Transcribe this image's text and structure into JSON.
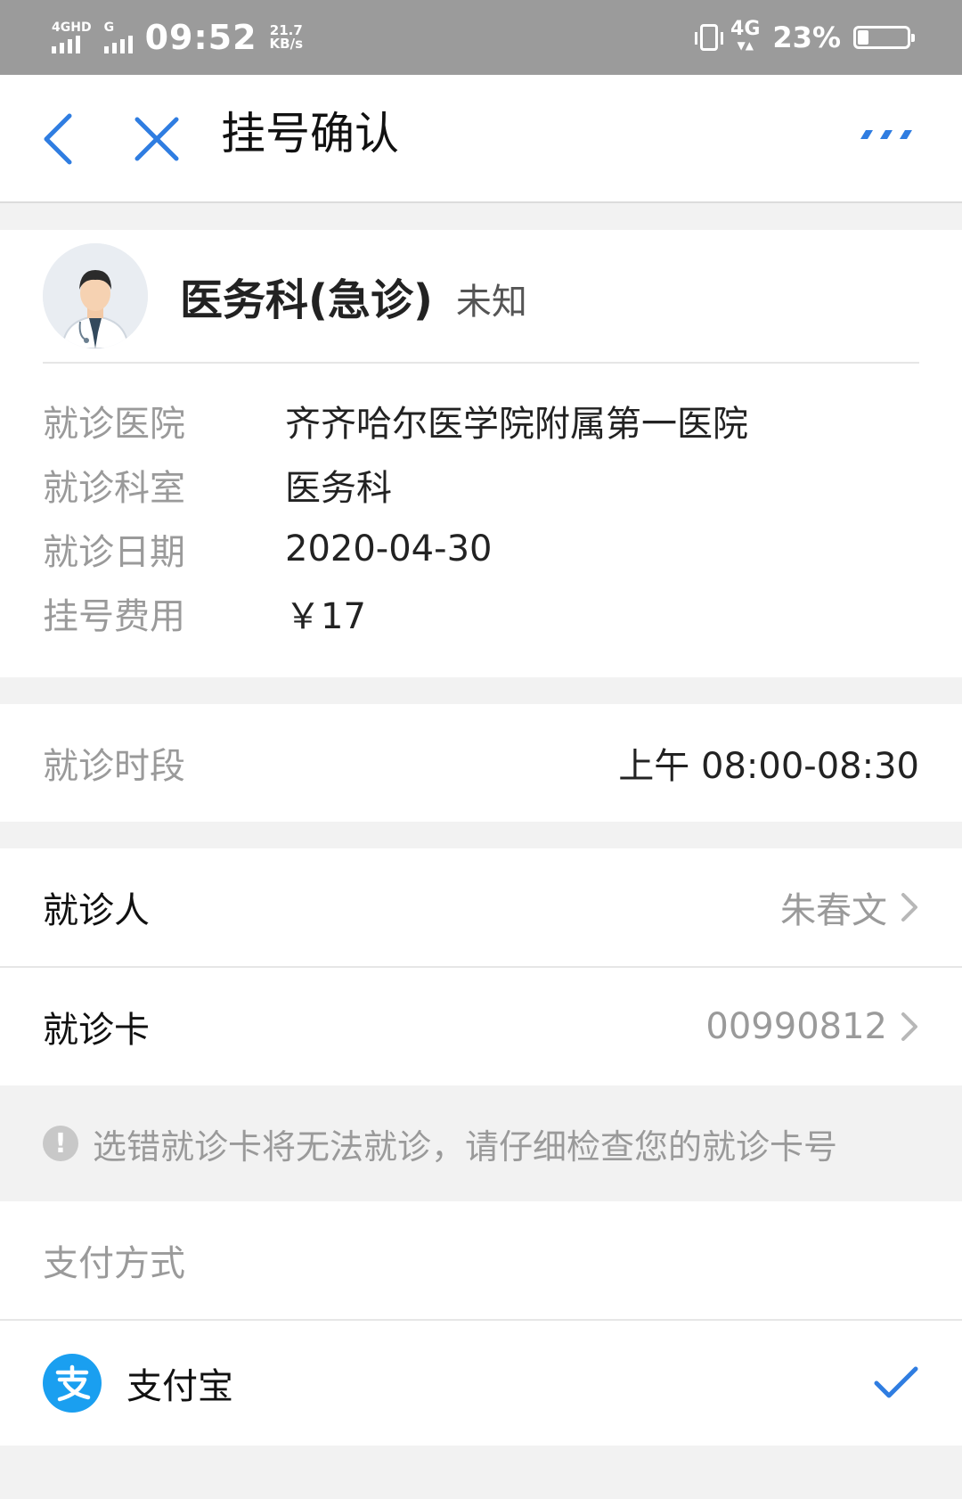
{
  "status_bar": {
    "network_left": "4GHD",
    "network_left2": "G",
    "time": "09:52",
    "speed_value": "21.7",
    "speed_unit": "KB/s",
    "network_right": "4G",
    "battery_percent": "23%",
    "battery_level": 0.23
  },
  "nav": {
    "title": "挂号确认",
    "back_icon": "chevron-left-icon",
    "close_icon": "close-icon",
    "more_icon": "more-icon",
    "accent_color": "#2f7de1"
  },
  "doctor": {
    "name": "医务科(急诊)",
    "title": "未知",
    "details": [
      {
        "label": "就诊医院",
        "value": "齐齐哈尔医学院附属第一医院"
      },
      {
        "label": "就诊科室",
        "value": "医务科"
      },
      {
        "label": "就诊日期",
        "value": "2020-04-30"
      },
      {
        "label": "挂号费用",
        "value": "￥17"
      }
    ]
  },
  "time_slot": {
    "label": "就诊时段",
    "value": "上午 08:00-08:30"
  },
  "patient": {
    "label": "就诊人",
    "value": "朱春文"
  },
  "card": {
    "label": "就诊卡",
    "value": "00990812"
  },
  "notice": "选错就诊卡将无法就诊，请仔细检查您的就诊卡号",
  "payment": {
    "section_label": "支付方式",
    "method": "支付宝",
    "selected": true,
    "brand_color": "#1a9ff0"
  }
}
